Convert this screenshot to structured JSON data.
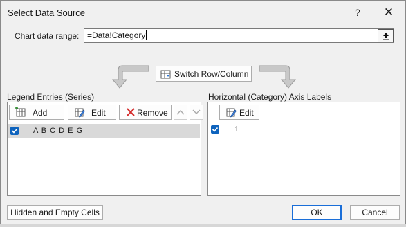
{
  "dialog": {
    "title": "Select Data Source",
    "help": "?",
    "close": "✕"
  },
  "range": {
    "label": "Chart data range:",
    "value": "=Data!Category"
  },
  "switch_button": {
    "label": "Switch Row/Column"
  },
  "legend": {
    "label": "Legend Entries (Series)",
    "add": "Add",
    "edit": "Edit",
    "remove": "Remove",
    "items": [
      {
        "name": "A B C D E G",
        "checked": true
      }
    ]
  },
  "axis": {
    "label": "Horizontal (Category) Axis Labels",
    "edit": "Edit",
    "items": [
      {
        "name": "1",
        "checked": true
      }
    ]
  },
  "footer": {
    "hidden_cells": "Hidden and Empty Cells",
    "ok": "OK",
    "cancel": "Cancel"
  },
  "colors": {
    "accent": "#0e63bd",
    "selection": "#d9d9d9"
  }
}
